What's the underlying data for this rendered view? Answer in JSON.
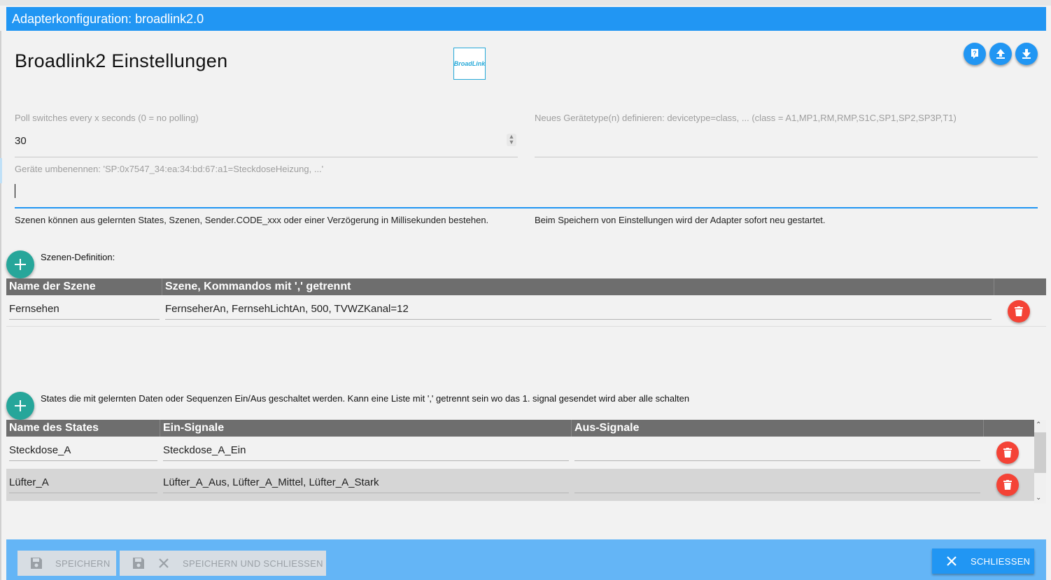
{
  "window": {
    "title": "Adapterkonfiguration: broadlink2.0"
  },
  "header": {
    "title": "Broadlink2 Einstellungen",
    "logo_text": "BroadLink",
    "icons": [
      "help-icon",
      "upload-icon",
      "download-icon"
    ]
  },
  "fields": {
    "poll": {
      "label": "Poll switches every x seconds (0 = no polling)",
      "value": "30"
    },
    "devicetype": {
      "label": "Neues Gerätetype(n) definieren: devicetype=class, ... (class = A1,MP1,RM,RMP,S1C,SP1,SP2,SP3P,T1)",
      "value": ""
    },
    "rename": {
      "label": "Geräte umbenennen: 'SP:0x7547_34:ea:34:bd:67:a1=SteckdoseHeizung, ...'",
      "value": ""
    }
  },
  "help": {
    "scenes": "Szenen können aus gelernten States, Szenen, Sender.CODE_xxx oder einer Verzögerung in Millisekunden bestehen.",
    "restart": "Beim Speichern von Einstellungen wird der Adapter sofort neu gestartet."
  },
  "scenes": {
    "label": "Szenen-Definition:",
    "columns": [
      "Name der Szene",
      "Szene, Kommandos mit ',' getrennt"
    ],
    "rows": [
      {
        "name": "Fernsehen",
        "commands": "FernseherAn, FernsehLichtAn, 500, TVWZKanal=12"
      }
    ]
  },
  "states": {
    "label": "States die mit gelernten Daten oder Sequenzen Ein/Aus geschaltet werden. Kann eine Liste mit ',' getrennt sein wo das 1. signal gesendet wird aber alle schalten",
    "columns": [
      "Name des States",
      "Ein-Signale",
      "Aus-Signale"
    ],
    "rows": [
      {
        "name": "Steckdose_A",
        "on": "Steckdose_A_Ein",
        "off": ""
      },
      {
        "name": "Lüfter_A",
        "on": "Lüfter_A_Aus, Lüfter_A_Mittel, Lüfter_A_Stark",
        "off": ""
      }
    ]
  },
  "footer": {
    "save": "SPEICHERN",
    "save_close": "SPEICHERN UND SCHLIESSEN",
    "close": "SCHLIESSEN"
  },
  "colors": {
    "accent": "#2196f3",
    "add": "#26a69a",
    "delete": "#f44336",
    "table_header": "#6e6e6e"
  }
}
